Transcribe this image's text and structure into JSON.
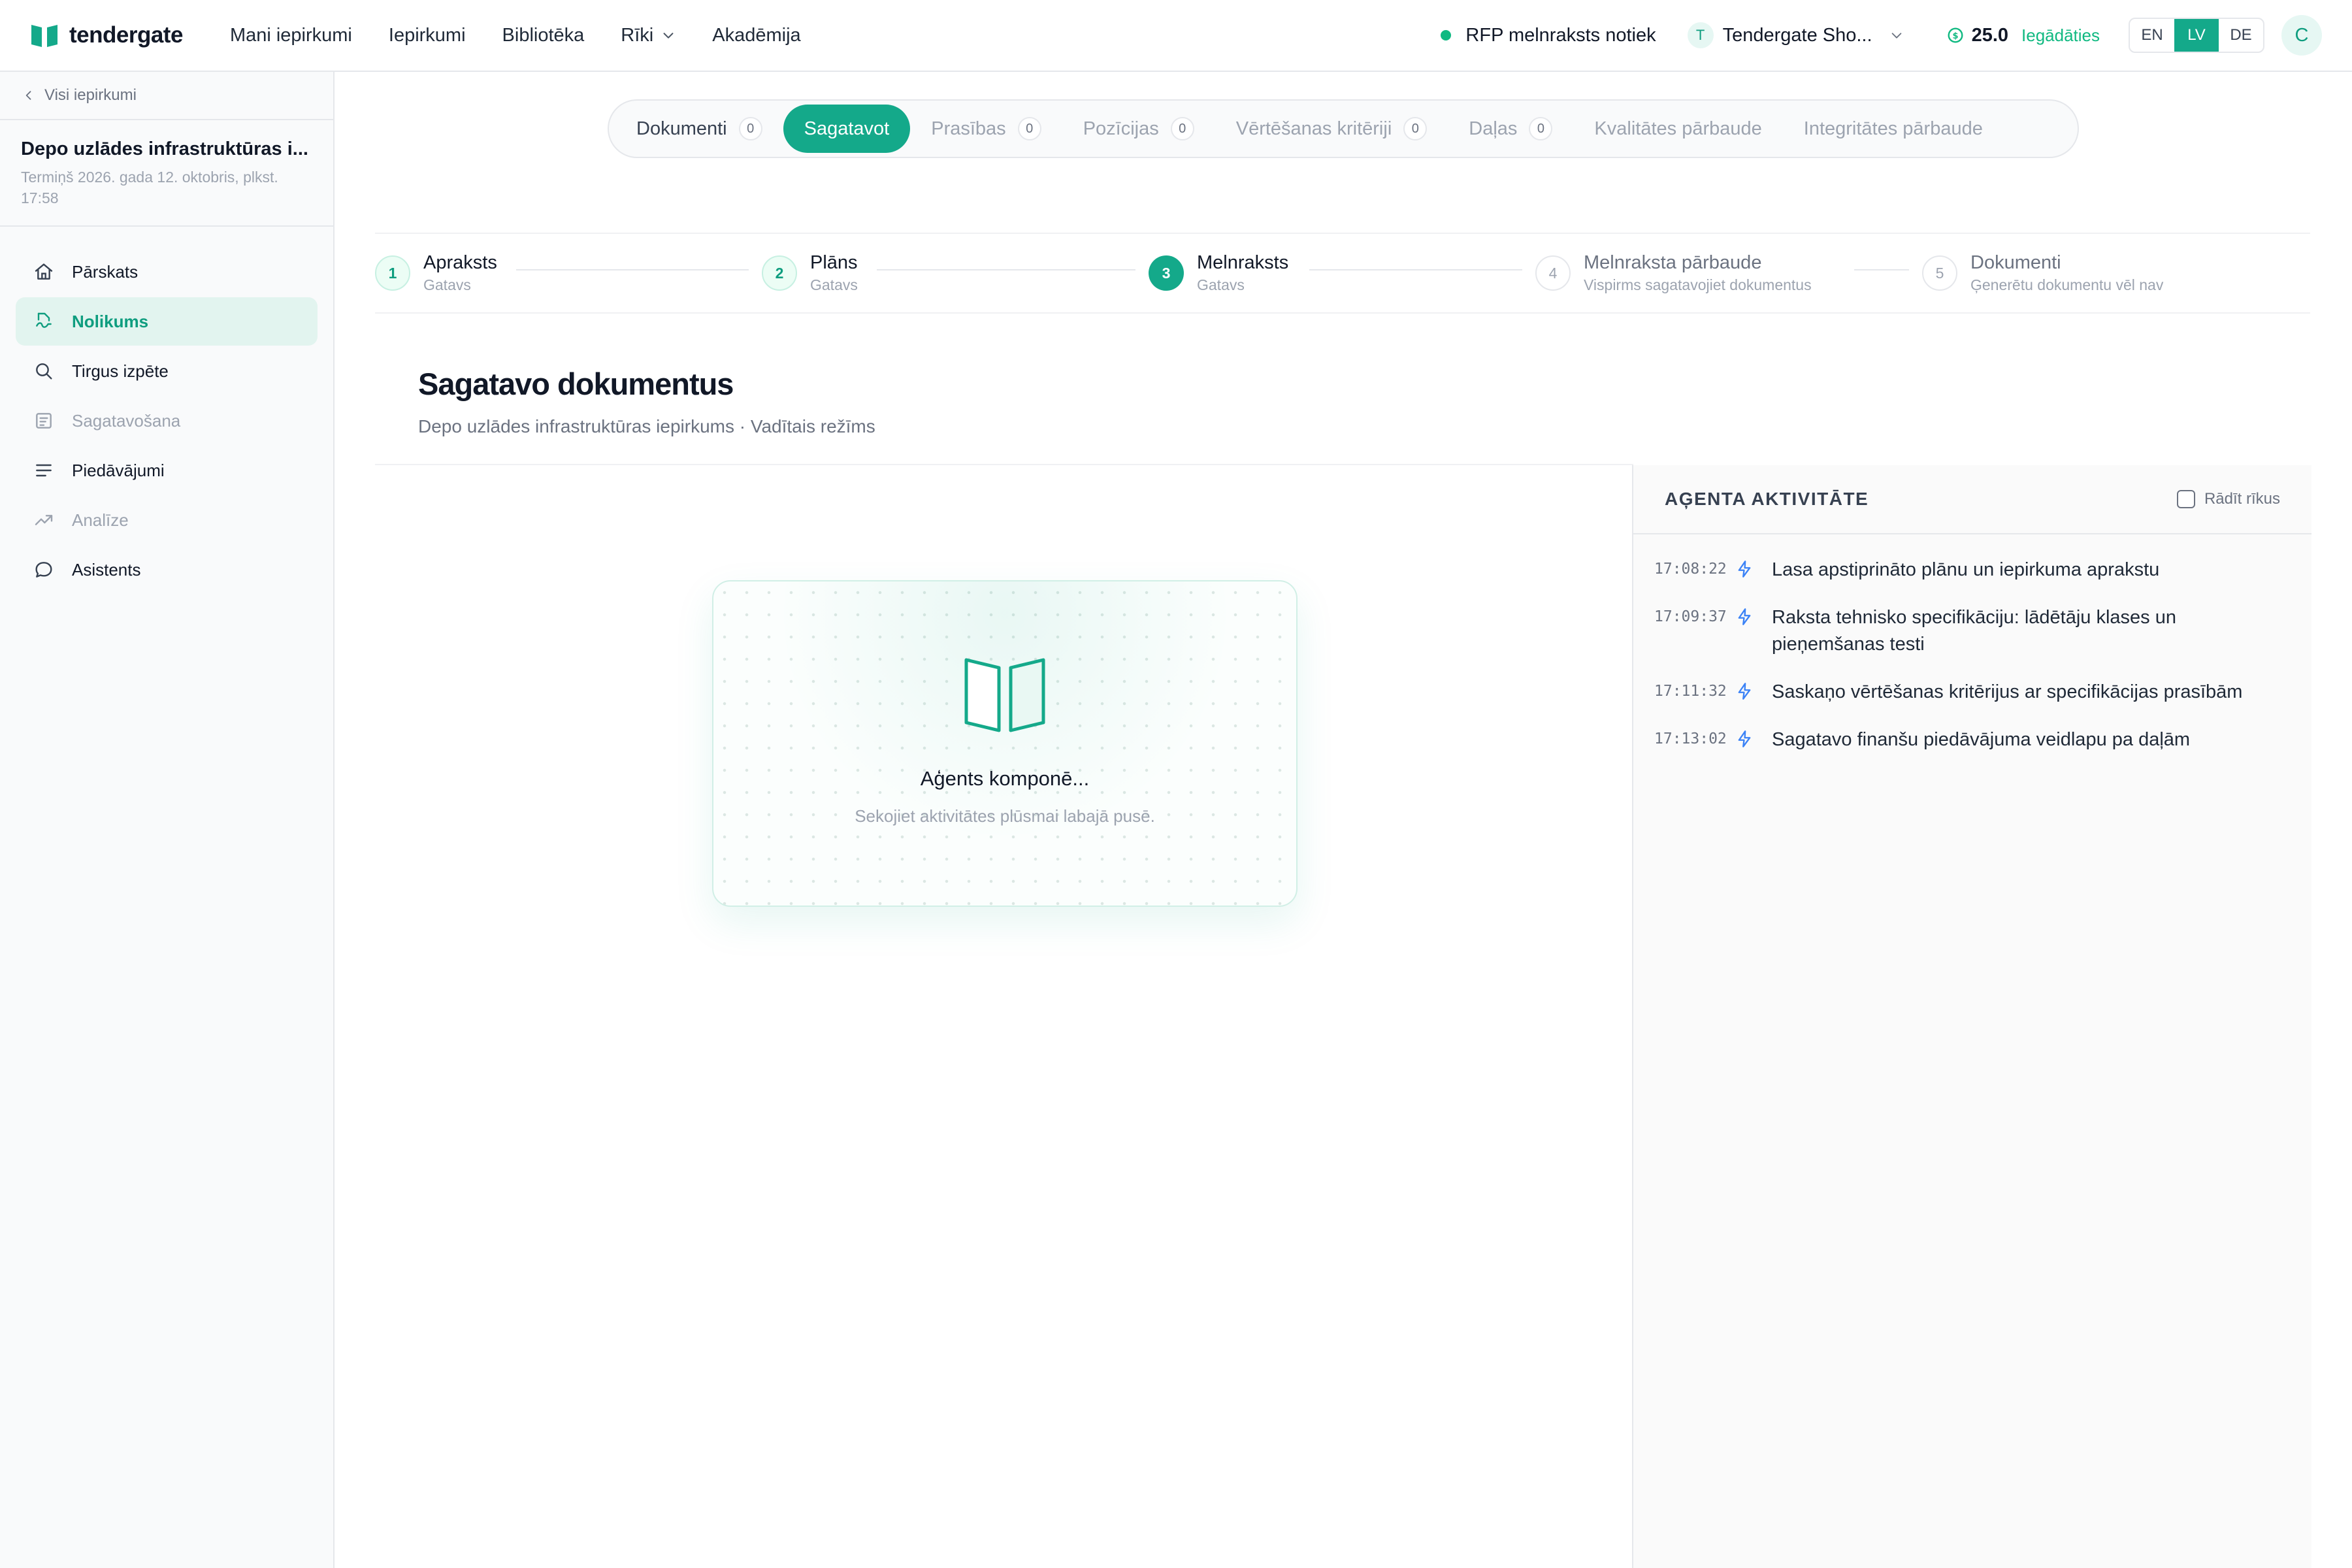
{
  "app": {
    "brand": "tendergate",
    "colors": {
      "accent": "#14a98a",
      "accent_light": "#e2f4ef",
      "status_dot": "#10b981",
      "credit_icon": "#10b981",
      "event_icon": "#3b82f6"
    }
  },
  "nav": {
    "items": [
      {
        "label": "Mani iepirkumi"
      },
      {
        "label": "Iepirkumi"
      },
      {
        "label": "Bibliotēka"
      },
      {
        "label": "Rīki",
        "has_dropdown": true
      },
      {
        "label": "Akadēmija"
      }
    ]
  },
  "status": {
    "label": "RFP melnraksts notiek"
  },
  "org": {
    "initial": "T",
    "name": "Tendergate Sho..."
  },
  "credits": {
    "value": "25.0",
    "topup_label": "Iegādāties"
  },
  "languages": {
    "items": [
      "EN",
      "LV",
      "DE"
    ],
    "selected": "LV"
  },
  "user": {
    "initial": "C"
  },
  "sidebar": {
    "back_label": "Visi iepirkumi",
    "project_title": "Depo uzlādes infrastruktūras i...",
    "project_deadline": "Termiņš 2026. gada 12. oktobris, plkst. 17:58",
    "items": [
      {
        "label": "Pārskats",
        "icon": "home-icon",
        "state": "normal"
      },
      {
        "label": "Nolikums",
        "icon": "document-icon",
        "state": "active"
      },
      {
        "label": "Tirgus izpēte",
        "icon": "search-icon",
        "state": "normal"
      },
      {
        "label": "Sagatavošana",
        "icon": "form-icon",
        "state": "muted"
      },
      {
        "label": "Piedāvājumi",
        "icon": "lines-icon",
        "state": "normal"
      },
      {
        "label": "Analīze",
        "icon": "trend-icon",
        "state": "muted"
      },
      {
        "label": "Asistents",
        "icon": "chat-icon",
        "state": "normal"
      }
    ]
  },
  "tabs": [
    {
      "label": "Dokumenti",
      "count": "0",
      "state": "enabled"
    },
    {
      "label": "Sagatavot",
      "state": "active"
    },
    {
      "label": "Prasības",
      "count": "0",
      "state": "disabled"
    },
    {
      "label": "Pozīcijas",
      "count": "0",
      "state": "disabled"
    },
    {
      "label": "Vērtēšanas kritēriji",
      "count": "0",
      "state": "disabled"
    },
    {
      "label": "Daļas",
      "count": "0",
      "state": "disabled"
    },
    {
      "label": "Kvalitātes pārbaude",
      "state": "disabled"
    },
    {
      "label": "Integritātes pārbaude",
      "state": "disabled"
    }
  ],
  "steps": [
    {
      "num": "1",
      "title": "Apraksts",
      "sub": "Gatavs",
      "state": "done"
    },
    {
      "num": "2",
      "title": "Plāns",
      "sub": "Gatavs",
      "state": "done"
    },
    {
      "num": "3",
      "title": "Melnraksts",
      "sub": "Gatavs",
      "state": "current"
    },
    {
      "num": "4",
      "title": "Melnraksta pārbaude",
      "sub": "Vispirms sagatavojiet dokumentus",
      "state": "todo"
    },
    {
      "num": "5",
      "title": "Dokumenti",
      "sub": "Ģenerētu dokumentu vēl nav",
      "state": "todo"
    }
  ],
  "page": {
    "title": "Sagatavo dokumentus",
    "subtitle": "Depo uzlādes infrastruktūras iepirkums · Vadītais režīms"
  },
  "agent": {
    "title": "Aģents komponē...",
    "subtitle": "Sekojiet aktivitātes plūsmai labajā pusē."
  },
  "activity": {
    "title": "AĢENTA AKTIVITĀTE",
    "show_tools_label": "Rādīt rīkus",
    "events": [
      {
        "time": "17:08:22",
        "text": "Lasa apstiprināto plānu un iepirkuma aprakstu"
      },
      {
        "time": "17:09:37",
        "text": "Raksta tehnisko specifikāciju: lādētāju klases un pieņemšanas testi"
      },
      {
        "time": "17:11:32",
        "text": "Saskaņo vērtēšanas kritērijus ar specifikācijas prasībām"
      },
      {
        "time": "17:13:02",
        "text": "Sagatavo finanšu piedāvājuma veidlapu pa daļām"
      }
    ]
  }
}
